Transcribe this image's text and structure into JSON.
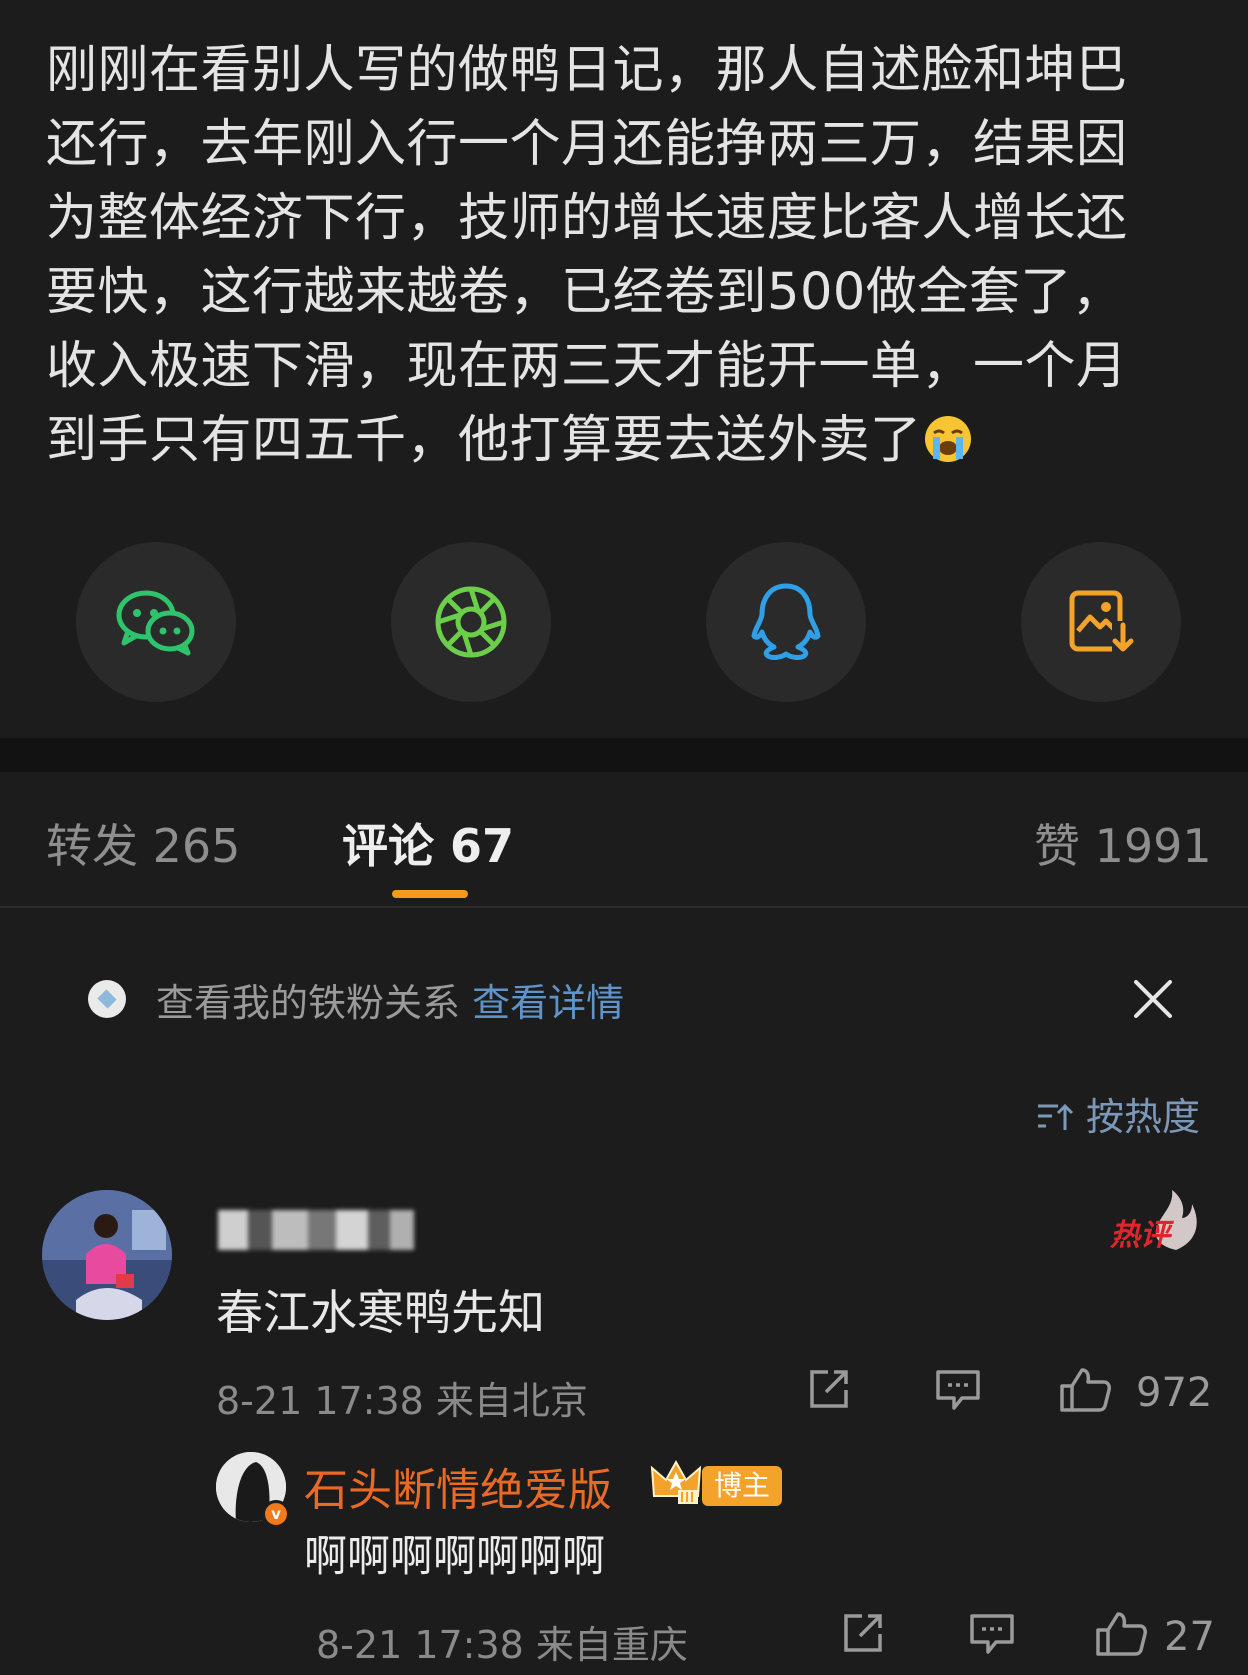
{
  "post": {
    "lines": [
      "刚刚在看别人写的做鸭日记，那人自述脸和坤巴",
      "还行，去年刚入行一个月还能挣两三万，结果因",
      "为整体经济下行，技师的增长速度比客人增长还",
      "要快，这行越来越卷，已经卷到500做全套了，",
      "收入极速下滑，现在两三天才能开一单，一个月",
      "到手只有四五千，他打算要去送外卖了"
    ],
    "emoji_icon": "loudly-crying-face-icon"
  },
  "share": {
    "buttons": [
      {
        "icon": "wechat-icon",
        "color": "#2fc36b"
      },
      {
        "icon": "moments-icon",
        "color": "#6ccf4a"
      },
      {
        "icon": "qq-icon",
        "color": "#2f9fe8"
      },
      {
        "icon": "save-image-icon",
        "color": "#f3a22a"
      }
    ]
  },
  "tabs": {
    "repost": "转发 265",
    "comments": "评论 67",
    "likes": "赞 1991",
    "accent": "#f39b18"
  },
  "fan_bar": {
    "text": "查看我的铁粉关系",
    "link": "查看详情"
  },
  "sort": {
    "label": "按热度"
  },
  "comment": {
    "hot_label": "热评",
    "text": "春江水寒鸭先知",
    "meta": "8-21 17:38 来自北京",
    "like_count": "972"
  },
  "reply": {
    "name": "石头断情绝爱版",
    "badge_v": "v",
    "tag": "博主",
    "text": "啊啊啊啊啊啊啊",
    "meta": "8-21 17:38 来自重庆",
    "like_count": "27",
    "name_color": "#e86a24"
  }
}
